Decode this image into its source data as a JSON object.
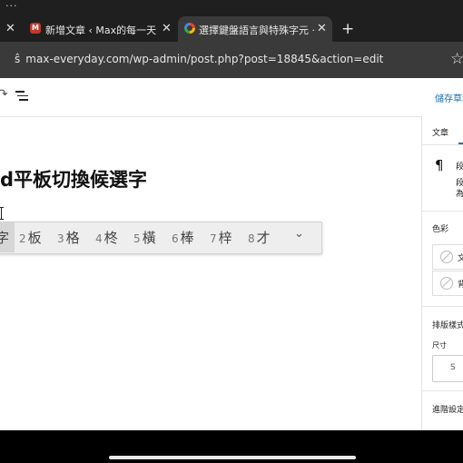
{
  "status": {
    "dots": "···"
  },
  "tabs": [
    {
      "title": "",
      "close": "✕"
    },
    {
      "title": "新增文章 ‹ Max的每一天 — W",
      "favicon": "M",
      "close": "✕"
    },
    {
      "title": "選擇鍵盤語言與特殊字元 · C",
      "close": "✕"
    }
  ],
  "new_tab": "+",
  "address": {
    "url": "max-everyday.com/wp-admin/post.php?post=18845&action=edit",
    "prefix": "ŝ"
  },
  "editor": {
    "save_draft": "儲存草稿",
    "post_title": "d平板切換候選字"
  },
  "ime": {
    "candidates": [
      {
        "num": "",
        "text": "字"
      },
      {
        "num": "2",
        "text": "板"
      },
      {
        "num": "3",
        "text": "格"
      },
      {
        "num": "4",
        "text": "柊"
      },
      {
        "num": "5",
        "text": "橫"
      },
      {
        "num": "6",
        "text": "棒"
      },
      {
        "num": "7",
        "text": "梓"
      },
      {
        "num": "8",
        "text": "才"
      }
    ],
    "more": "⌄"
  },
  "sidebar": {
    "tab_post": "文章",
    "block_line1": "段",
    "block_line2": "段",
    "block_line3": "為",
    "color_heading": "色彩",
    "color_text": "文",
    "color_bg": "背",
    "typography_heading": "排版樣式",
    "size_label": "尺寸",
    "size_value": "S",
    "advanced": "進階設定"
  }
}
